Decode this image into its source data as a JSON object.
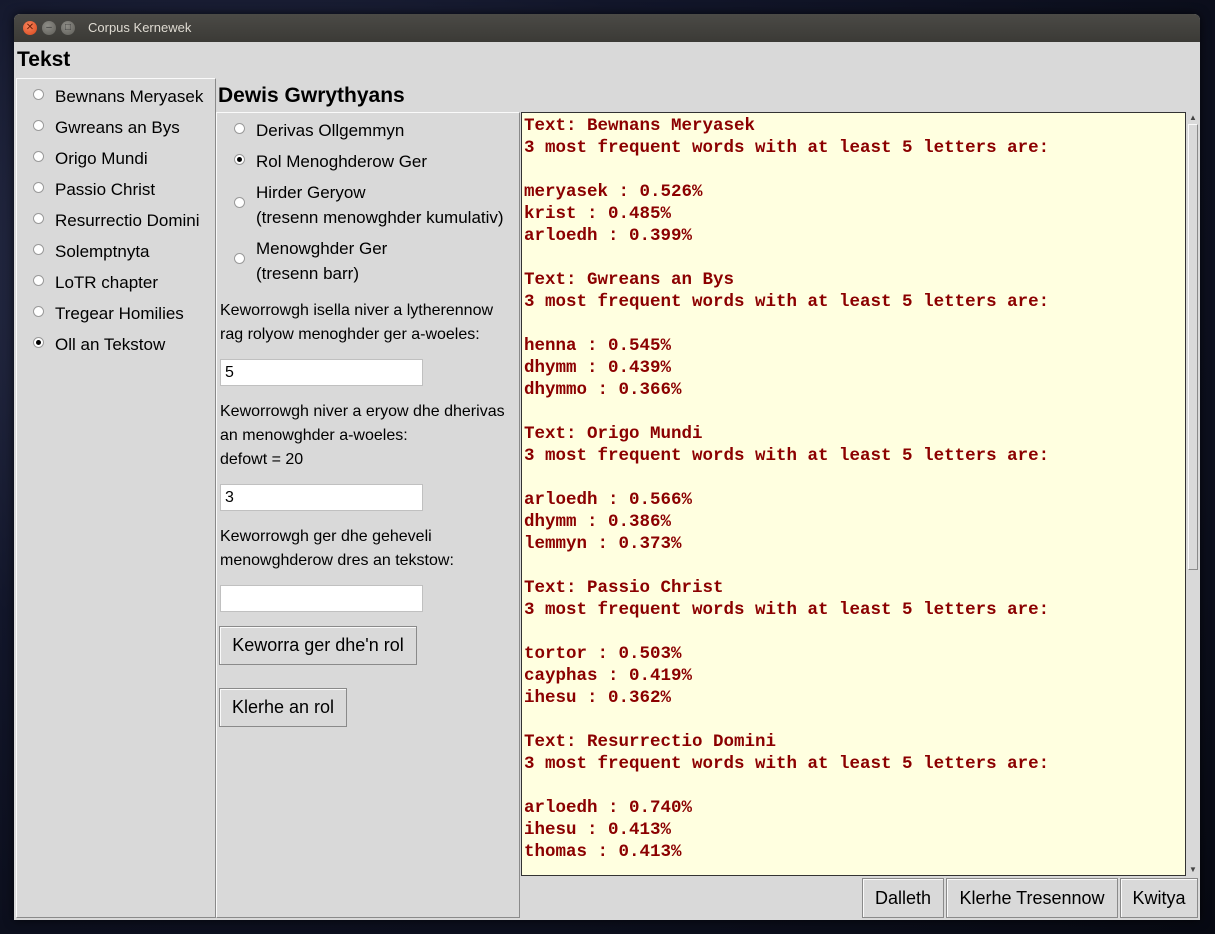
{
  "window": {
    "title": "Corpus Kernewek"
  },
  "texts": {
    "heading": "Tekst",
    "selected": "Oll an Tekstow",
    "items": [
      "Bewnans Meryasek",
      "Gwreans an Bys",
      "Origo Mundi",
      "Passio Christ",
      "Resurrectio Domini",
      "Solemptnyta",
      "LoTR chapter",
      "Tregear Homilies",
      "Oll an Tekstow"
    ]
  },
  "functions": {
    "heading": "Dewis Gwrythyans",
    "selected": "Rol Menoghderow Ger",
    "options": [
      {
        "line1": "Derivas Ollgemmyn",
        "line2": ""
      },
      {
        "line1": "Rol Menoghderow Ger",
        "line2": ""
      },
      {
        "line1": "Hirder Geryow",
        "line2": "(tresenn menowghder kumulativ)"
      },
      {
        "line1": "Menowghder Ger",
        "line2": "(tresenn barr)"
      }
    ]
  },
  "form": {
    "min_letters_prompt_1": "Keworrowgh isella niver a lytherennow",
    "min_letters_prompt_2": "rag rolyow menoghder ger a-woeles:",
    "min_letters_value": "5",
    "num_words_prompt_1": "Keworrowgh niver a eryow dhe dherivas",
    "num_words_prompt_2": "an menowghder a-woeles:",
    "num_words_prompt_3": "defowt = 20",
    "num_words_value": "3",
    "compare_prompt_1": "Keworrowgh ger dhe geheveli",
    "compare_prompt_2": "menowghderow dres an tekstow:",
    "compare_value": "",
    "add_word_button": "Keworra ger dhe'n rol",
    "clear_list_button": "Klerhe an rol"
  },
  "output": {
    "text": "Text: Bewnans Meryasek\n3 most frequent words with at least 5 letters are:\n\nmeryasek : 0.526%\nkrist : 0.485%\narloedh : 0.399%\n\nText: Gwreans an Bys\n3 most frequent words with at least 5 letters are:\n\nhenna : 0.545%\ndhymm : 0.439%\ndhymmo : 0.366%\n\nText: Origo Mundi\n3 most frequent words with at least 5 letters are:\n\narloedh : 0.566%\ndhymm : 0.386%\nlemmyn : 0.373%\n\nText: Passio Christ\n3 most frequent words with at least 5 letters are:\n\ntortor : 0.503%\ncayphas : 0.419%\nihesu : 0.362%\n\nText: Resurrectio Domini\n3 most frequent words with at least 5 letters are:\n\narloedh : 0.740%\nihesu : 0.413%\nthomas : 0.413%"
  },
  "bottom_buttons": {
    "start": "Dalleth",
    "clear_plots": "Klerhe Tresennow",
    "quit": "Kwitya"
  },
  "colors": {
    "output_bg": "#ffffe0",
    "output_text": "#8b0000",
    "window_bg": "#d9d9d9"
  }
}
